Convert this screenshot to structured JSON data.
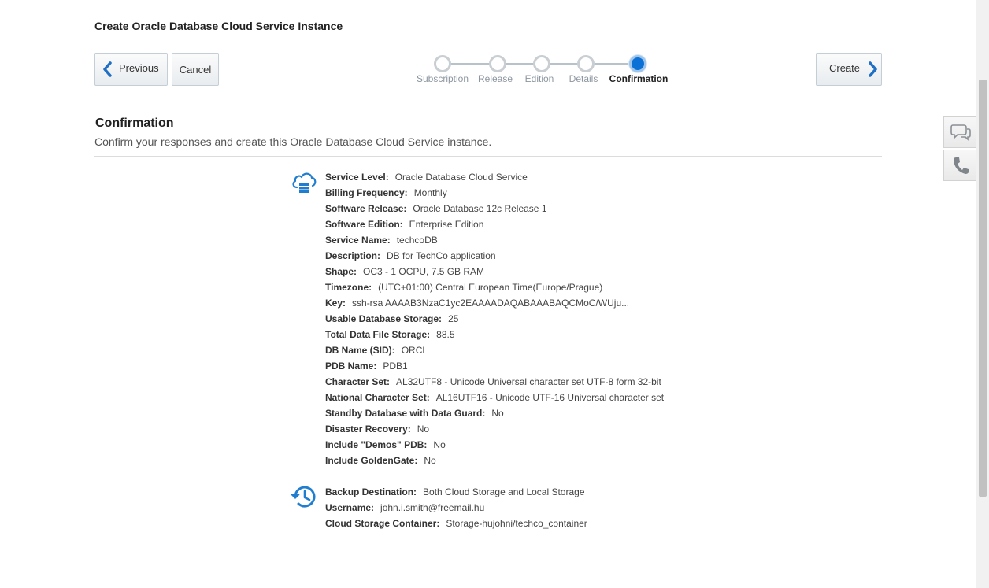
{
  "header": {
    "title": "Create Oracle Database Cloud Service Instance"
  },
  "nav": {
    "previous_label": "Previous",
    "cancel_label": "Cancel",
    "create_label": "Create"
  },
  "train": {
    "steps": [
      {
        "label": "Subscription",
        "state": "visited"
      },
      {
        "label": "Release",
        "state": "visited"
      },
      {
        "label": "Edition",
        "state": "visited"
      },
      {
        "label": "Details",
        "state": "visited"
      },
      {
        "label": "Confirmation",
        "state": "current"
      }
    ]
  },
  "section": {
    "title": "Confirmation",
    "description": "Confirm your responses and create this Oracle Database Cloud Service instance."
  },
  "service_details": {
    "icon": "cloud-database-icon",
    "rows": [
      {
        "label": "Service Level:",
        "value": "Oracle Database Cloud Service"
      },
      {
        "label": "Billing Frequency:",
        "value": "Monthly"
      },
      {
        "label": "Software Release:",
        "value": "Oracle Database 12c Release 1"
      },
      {
        "label": "Software Edition:",
        "value": "Enterprise Edition"
      },
      {
        "label": "Service Name:",
        "value": "techcoDB"
      },
      {
        "label": "Description:",
        "value": "DB for TechCo application"
      },
      {
        "label": "Shape:",
        "value": "OC3 - 1 OCPU, 7.5 GB RAM"
      },
      {
        "label": "Timezone:",
        "value": "(UTC+01:00) Central European Time(Europe/Prague)"
      },
      {
        "label": "Key:",
        "value": "ssh-rsa AAAAB3NzaC1yc2EAAAADAQABAAABAQCMoC/WUju..."
      },
      {
        "label": "Usable Database Storage:",
        "value": "25"
      },
      {
        "label": "Total Data File Storage:",
        "value": "88.5"
      },
      {
        "label": "DB Name (SID):",
        "value": "ORCL"
      },
      {
        "label": "PDB Name:",
        "value": "PDB1"
      },
      {
        "label": "Character Set:",
        "value": "AL32UTF8 - Unicode Universal character set UTF-8 form 32-bit"
      },
      {
        "label": "National Character Set:",
        "value": "AL16UTF16 - Unicode UTF-16 Universal character set"
      },
      {
        "label": "Standby Database with Data Guard:",
        "value": "No"
      },
      {
        "label": "Disaster Recovery:",
        "value": "No"
      },
      {
        "label": "Include \"Demos\" PDB:",
        "value": "No"
      },
      {
        "label": "Include GoldenGate:",
        "value": "No"
      }
    ]
  },
  "backup_details": {
    "icon": "backup-history-icon",
    "rows": [
      {
        "label": "Backup Destination:",
        "value": "Both Cloud Storage and Local Storage"
      },
      {
        "label": "Username:",
        "value": "john.i.smith@freemail.hu"
      },
      {
        "label": "Cloud Storage Container:",
        "value": "Storage-hujohni/techco_container"
      }
    ]
  },
  "side_widgets": [
    {
      "icon": "chat-icon"
    },
    {
      "icon": "phone-icon"
    }
  ],
  "colors": {
    "accent": "#0b71d6",
    "icon_blue": "#1f7ed0",
    "train_inactive": "#c9ced2"
  }
}
